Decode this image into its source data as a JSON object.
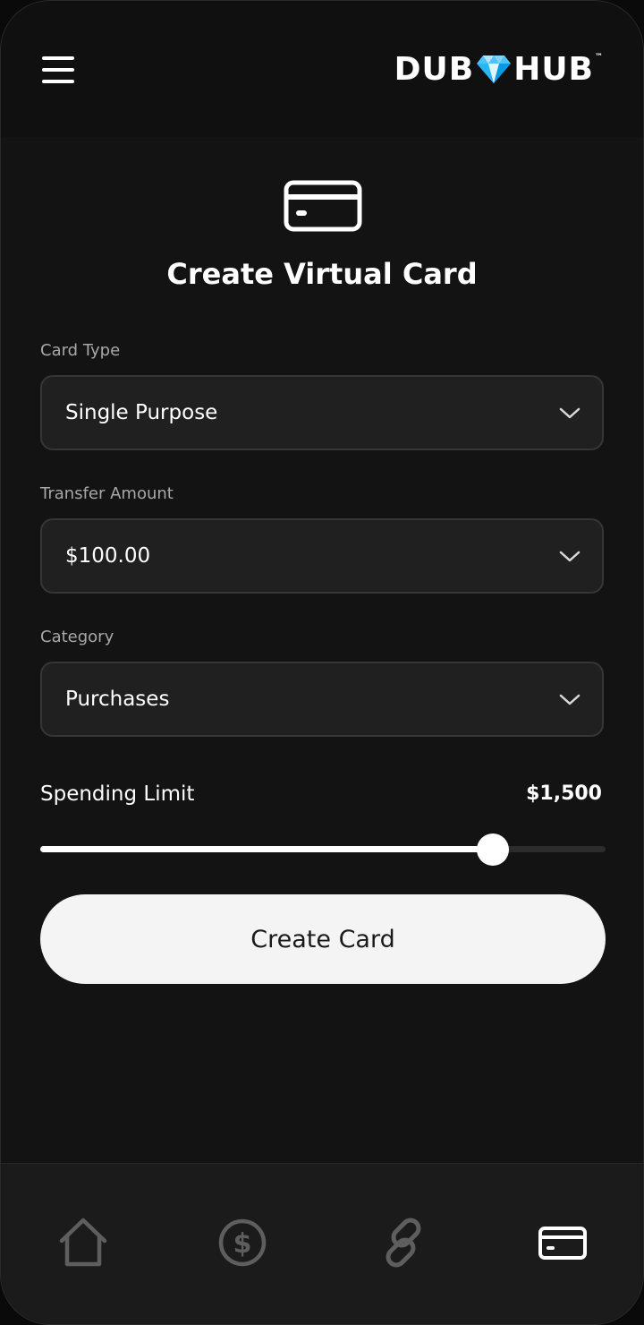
{
  "header": {
    "menu_icon": "hamburger-menu-icon",
    "logo": {
      "left": "DUB",
      "gem_icon": "diamond-icon",
      "right": "HUB",
      "trademark": "™"
    }
  },
  "main": {
    "hero_icon": "credit-card-icon",
    "title": "Create Virtual Card",
    "fields": {
      "card_type": {
        "label": "Card Type",
        "value": "Single Purpose"
      },
      "transfer_amount": {
        "label": "Transfer Amount",
        "value": "$100.00"
      },
      "category": {
        "label": "Category",
        "value": "Purchases"
      }
    },
    "spending_limit": {
      "label": "Spending Limit",
      "value": "$1,500",
      "slider_fraction": 0.8
    },
    "create_button": "Create Card"
  },
  "bottom_nav": {
    "items": [
      {
        "icon": "home-icon",
        "active": false
      },
      {
        "icon": "dollar-circle-icon",
        "active": false
      },
      {
        "icon": "link-icon",
        "active": false
      },
      {
        "icon": "credit-card-icon",
        "active": true
      }
    ]
  },
  "colors": {
    "background": "#131313",
    "field_background": "#202020",
    "field_border": "#363636",
    "text": "#ffffff",
    "label": "#a8a8a8",
    "button": "#f4f4f4",
    "nav_inactive": "#5e5e5e",
    "nav_active": "#ffffff",
    "gem": "#4fc3f7"
  }
}
